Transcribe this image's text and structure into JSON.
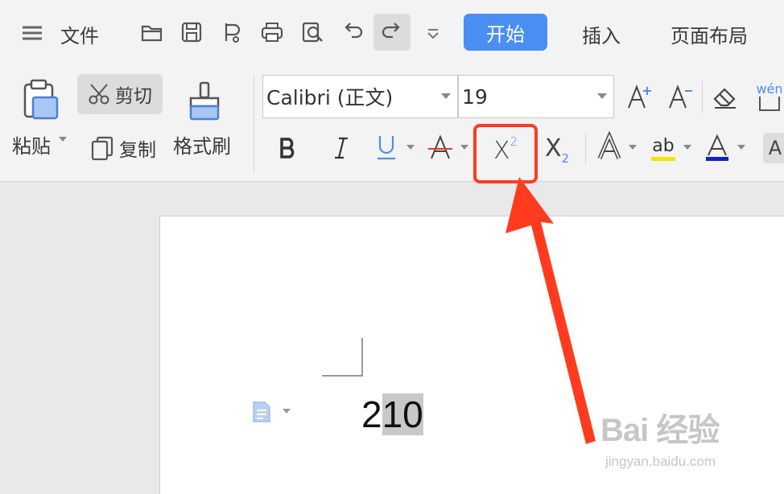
{
  "menu": {
    "file_label": "文件",
    "tabs": [
      {
        "label": "开始",
        "active": true
      },
      {
        "label": "插入"
      },
      {
        "label": "页面布局"
      }
    ]
  },
  "clipboard": {
    "paste_label": "粘贴",
    "cut_label": "剪切",
    "copy_label": "复制",
    "format_painter_label": "格式刷"
  },
  "font": {
    "family_value": "Calibri (正文)",
    "size_value": "19",
    "phonetic_glyph": "wén"
  },
  "format_buttons": {
    "superscript": {
      "base": "X",
      "mark": "2"
    },
    "subscript": {
      "base": "X",
      "mark": "2"
    }
  },
  "document": {
    "text_before": "2",
    "selected_text": "10"
  },
  "watermark": {
    "main": "Bai  经验",
    "sub": "jingyan.baidu.com"
  },
  "colors": {
    "accent": "#4b8ef2",
    "annotation": "#ff3b1f",
    "highlight_yellow": "#f5e400",
    "font_color_blue": "#1020d0"
  }
}
